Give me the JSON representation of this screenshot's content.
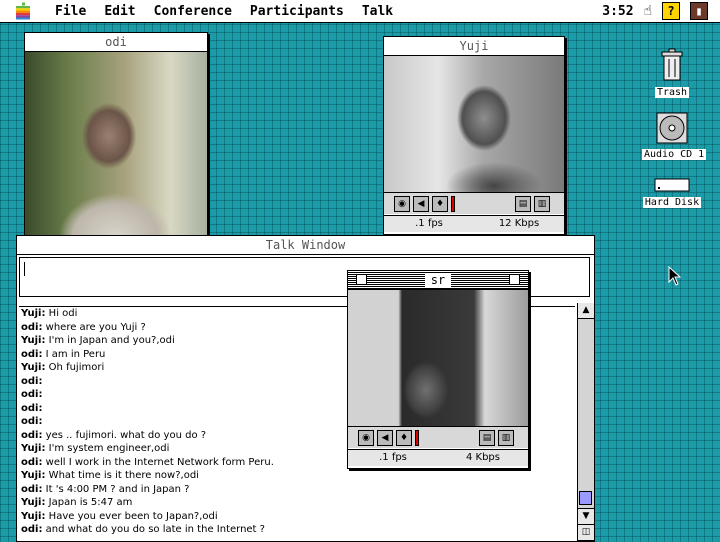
{
  "menubar": {
    "items": [
      "File",
      "Edit",
      "Conference",
      "Participants",
      "Talk"
    ],
    "clock": "3:52",
    "icons": [
      "apple-icon",
      "balloon-help-icon",
      "application-menu-icon"
    ]
  },
  "windows": {
    "odi": {
      "title": "odi"
    },
    "yuji": {
      "title": "Yuji",
      "fps": ".1 fps",
      "rate": "12 Kbps"
    },
    "sr": {
      "title": "sr",
      "fps": ".1 fps",
      "rate": "4 Kbps"
    },
    "talk": {
      "title": "Talk Window",
      "input_value": "",
      "messages": [
        {
          "who": "Yuji:",
          "text": " Hi odi"
        },
        {
          "who": "odi:",
          "text": " where are you Yuji ?"
        },
        {
          "who": "Yuji:",
          "text": " I'm in Japan and you?,odi"
        },
        {
          "who": "odi:",
          "text": " I am in Peru"
        },
        {
          "who": "Yuji:",
          "text": " Oh fujimori"
        },
        {
          "who": "odi:",
          "text": ""
        },
        {
          "who": "odi:",
          "text": ""
        },
        {
          "who": "odi:",
          "text": ""
        },
        {
          "who": "odi:",
          "text": ""
        },
        {
          "who": "odi:",
          "text": " yes .. fujimori. what do you do ?"
        },
        {
          "who": "Yuji:",
          "text": " I'm system engineer,odi"
        },
        {
          "who": "odi:",
          "text": " well I work in the Internet Network form Peru."
        },
        {
          "who": "Yuji:",
          "text": " What time is it there now?,odi"
        },
        {
          "who": "odi:",
          "text": " It 's 4:00 PM ? and in Japan ?"
        },
        {
          "who": "Yuji:",
          "text": " Japan is 5:47 am"
        },
        {
          "who": "Yuji:",
          "text": " Have you ever been to Japan?,odi"
        },
        {
          "who": "odi:",
          "text": " and what do you do so late in the Internet ?"
        }
      ]
    }
  },
  "desktop": {
    "trash": "Trash",
    "cd": "Audio CD 1",
    "disk": "Hard Disk"
  },
  "colors": {
    "desktop": "#1b9aa7",
    "level_meter": "#d00000"
  }
}
